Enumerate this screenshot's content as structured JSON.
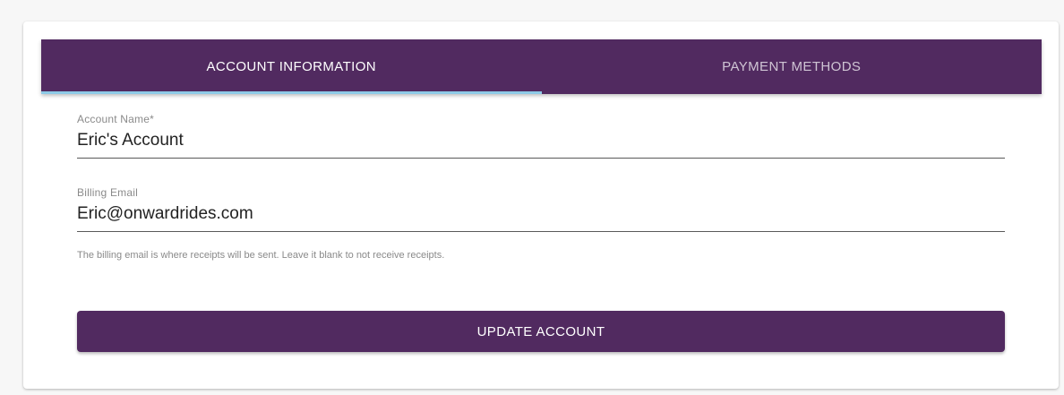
{
  "colors": {
    "brand": "#512a60",
    "tab_indicator": "#8ecae6"
  },
  "tabs": [
    {
      "label": "ACCOUNT INFORMATION",
      "active": true
    },
    {
      "label": "PAYMENT METHODS",
      "active": false
    }
  ],
  "form": {
    "account_name": {
      "label": "Account Name*",
      "value": "Eric's Account"
    },
    "billing_email": {
      "label": "Billing Email",
      "value": "Eric@onwardrides.com",
      "helper": "The billing email is where receipts will be sent. Leave it blank to not receive receipts."
    },
    "submit_label": "UPDATE ACCOUNT"
  }
}
